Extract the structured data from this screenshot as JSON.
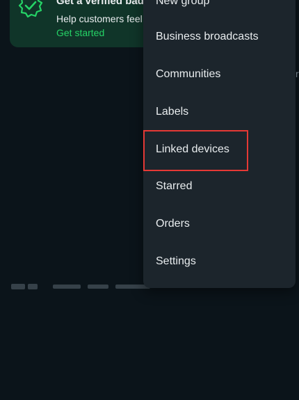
{
  "promo": {
    "title": "Get a verified badge",
    "description": "Help customers feel",
    "cta": "Get started",
    "icon": "verified-badge-icon"
  },
  "menu": {
    "items": [
      {
        "label": "New group"
      },
      {
        "label": "Business broadcasts"
      },
      {
        "label": "Communities"
      },
      {
        "label": "Labels"
      },
      {
        "label": "Linked devices"
      },
      {
        "label": "Starred"
      },
      {
        "label": "Orders"
      },
      {
        "label": "Settings"
      }
    ]
  },
  "colors": {
    "background": "#0b141a",
    "menu_background": "#1c252c",
    "promo_background": "#103529",
    "accent_green": "#25d366",
    "highlight_red": "#e53935"
  },
  "edge_glyph": "r"
}
